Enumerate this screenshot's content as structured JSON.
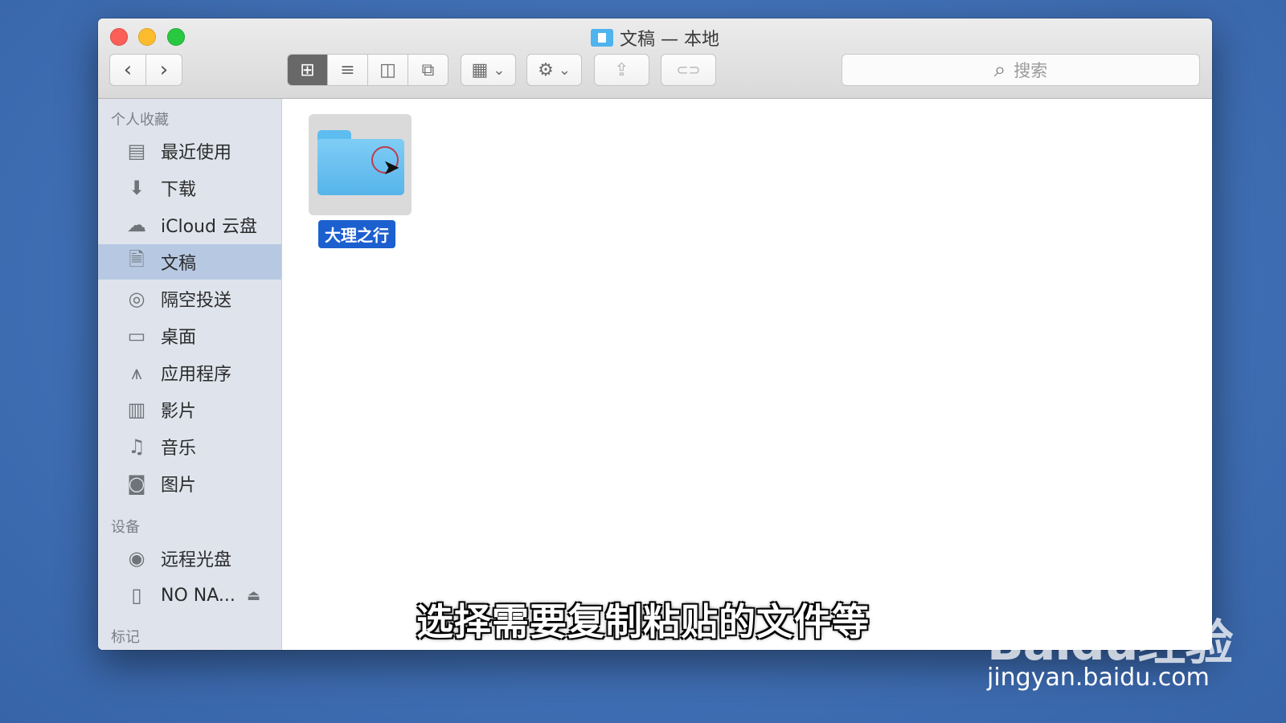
{
  "window": {
    "title": "文稿 — 本地"
  },
  "toolbar": {
    "back_icon": "‹",
    "forward_icon": "›",
    "views": [
      {
        "icon": "icon-view-icon",
        "glyph": "⊞",
        "active": true
      },
      {
        "icon": "list-view-icon",
        "glyph": "≡",
        "active": false
      },
      {
        "icon": "column-view-icon",
        "glyph": "◫",
        "active": false
      },
      {
        "icon": "gallery-view-icon",
        "glyph": "⧉",
        "active": false
      }
    ],
    "arrange_glyph": "▦",
    "action_glyph": "⚙",
    "chevron": "⌄",
    "share_glyph": "⇪",
    "tag_glyph": "⊂⊃",
    "search_icon": "⌕",
    "search_placeholder": "搜索"
  },
  "sidebar": {
    "favorites_header": "个人收藏",
    "favorites": [
      {
        "label": "最近使用",
        "icon": "recents-icon",
        "glyph": "▤"
      },
      {
        "label": "下载",
        "icon": "downloads-icon",
        "glyph": "⬇"
      },
      {
        "label": "iCloud 云盘",
        "icon": "icloud-icon",
        "glyph": "☁"
      },
      {
        "label": "文稿",
        "icon": "documents-icon",
        "glyph": "🗎",
        "selected": true
      },
      {
        "label": "隔空投送",
        "icon": "airdrop-icon",
        "glyph": "◎"
      },
      {
        "label": "桌面",
        "icon": "desktop-icon",
        "glyph": "▭"
      },
      {
        "label": "应用程序",
        "icon": "applications-icon",
        "glyph": "⩚"
      },
      {
        "label": "影片",
        "icon": "movies-icon",
        "glyph": "▥"
      },
      {
        "label": "音乐",
        "icon": "music-icon",
        "glyph": "♫"
      },
      {
        "label": "图片",
        "icon": "pictures-icon",
        "glyph": "◙"
      }
    ],
    "devices_header": "设备",
    "devices": [
      {
        "label": "远程光盘",
        "icon": "remote-disc-icon",
        "glyph": "◉"
      },
      {
        "label": "NO NA...",
        "icon": "drive-icon",
        "glyph": "▯",
        "eject": "⏏"
      }
    ],
    "tags_header": "标记"
  },
  "files": [
    {
      "name": "大理之行",
      "icon": "folder-icon",
      "selected": true
    }
  ],
  "overlay": {
    "subtitle": "选择需要复制粘贴的文件等",
    "watermark_logo": "Baidu经验",
    "watermark_url": "jingyan.baidu.com"
  },
  "colors": {
    "desktop": "#4170b6",
    "sidebar": "#dfe4ec",
    "selection_sidebar": "#b7c9e2",
    "file_label": "#1c5fcf",
    "folder": "#56b4ea"
  }
}
